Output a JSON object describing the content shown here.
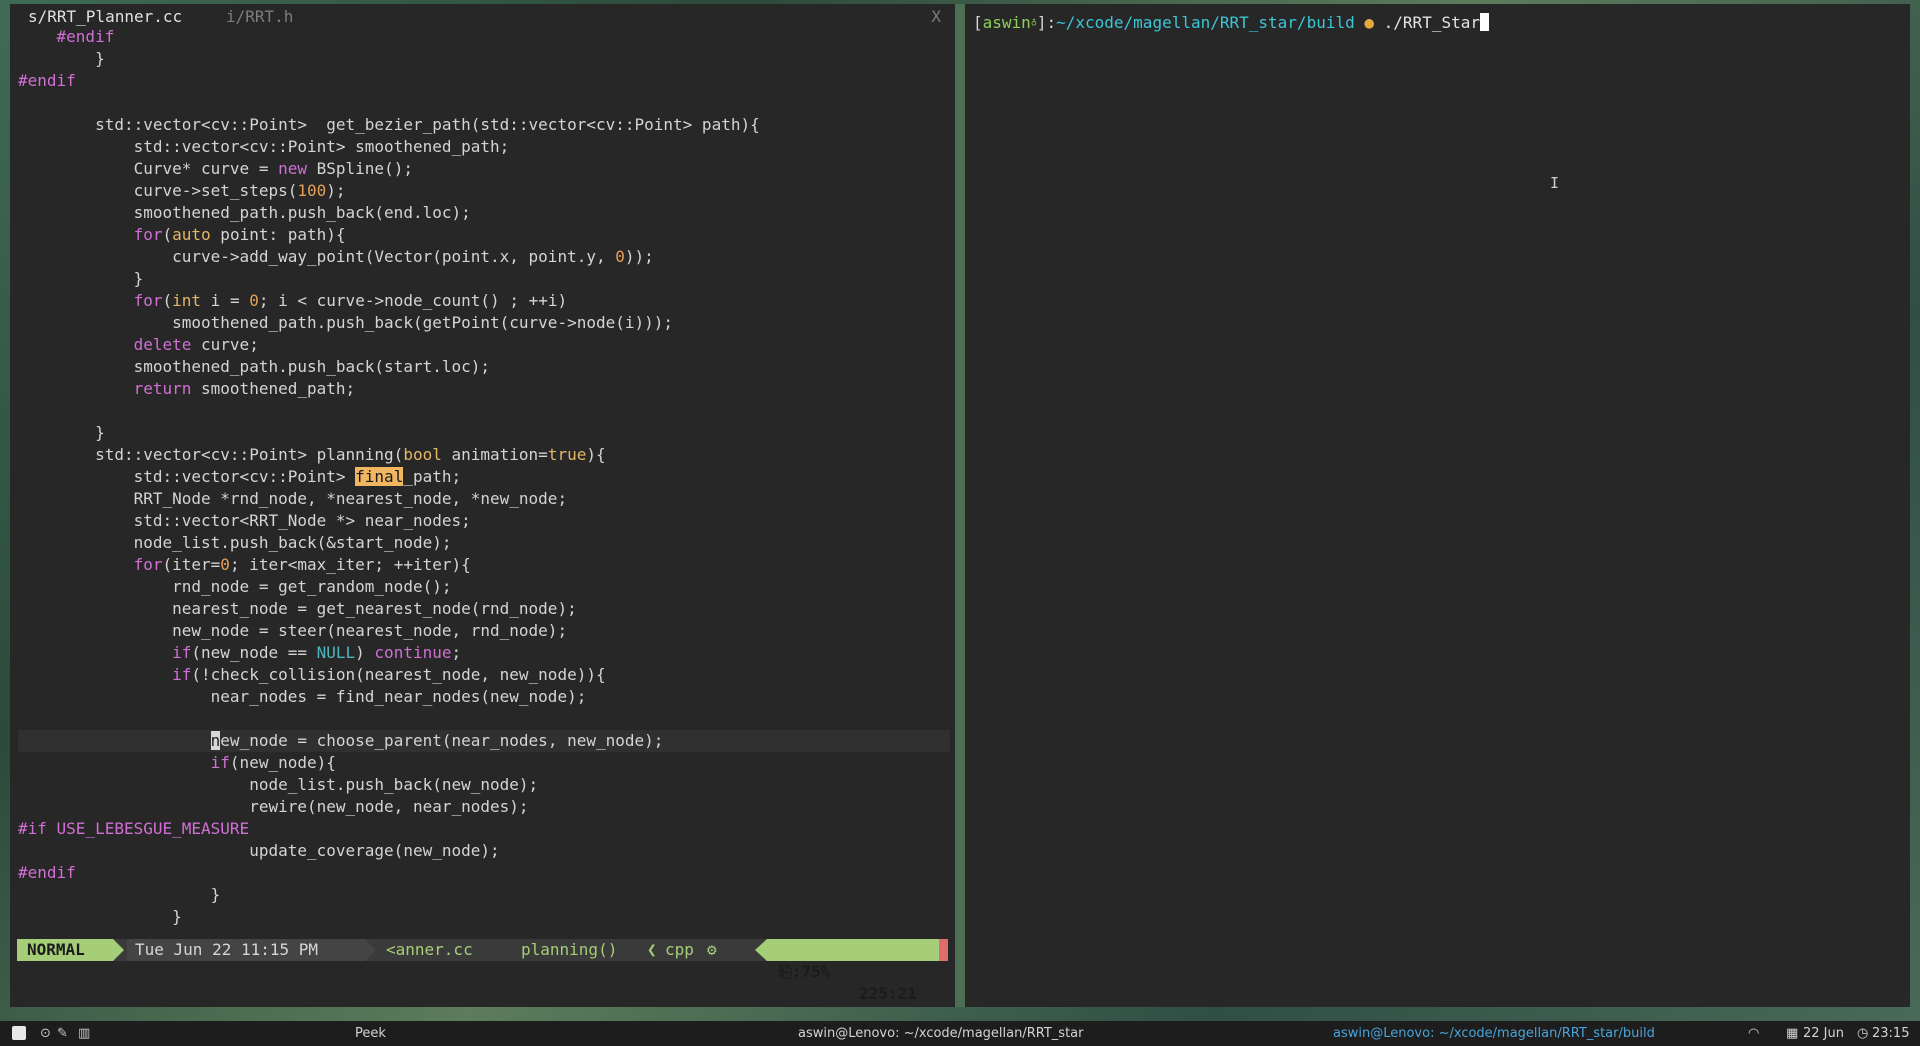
{
  "editor": {
    "tabs": {
      "active": "s/RRT_Planner.cc",
      "inactive": "i/RRT.h",
      "close": "X"
    },
    "statusline": {
      "mode": "NORMAL",
      "datetime": "Tue Jun 22 11:15 PM",
      "file": "<anner.cc",
      "function": "planning()",
      "sep": "❮",
      "filetype": "cpp",
      "gear": "⚙",
      "percent": "⎘:75%",
      "position": "225:21"
    }
  },
  "terminal": {
    "prompt_open": "[",
    "user": "aswin",
    "user_mark": "♁",
    "prompt_close": "]:",
    "path": "~/xcode/magellan/RRT_star/build",
    "git_mark": "●",
    "command": "./RRT_Star",
    "mouse_cursor": "I"
  },
  "taskbar": {
    "ws1": "⊙",
    "ws2": "✎",
    "ws3": "▥",
    "peek": "Peek",
    "window1": "aswin@Lenovo: ~/xcode/magellan/RRT_star",
    "window2": "aswin@Lenovo: ~/xcode/magellan/RRT_star/build",
    "wifi_icon": "◠",
    "calendar_icon": "▦",
    "date": "22 Jun",
    "clock_icon": "◷",
    "time": "23:15"
  },
  "colors": {
    "pane_bg": "#272727",
    "accent_green": "#a6ce78",
    "keyword": "#d16fd5",
    "type": "#e5b567",
    "number": "#e69f54",
    "path_cyan": "#3bc6d6"
  }
}
